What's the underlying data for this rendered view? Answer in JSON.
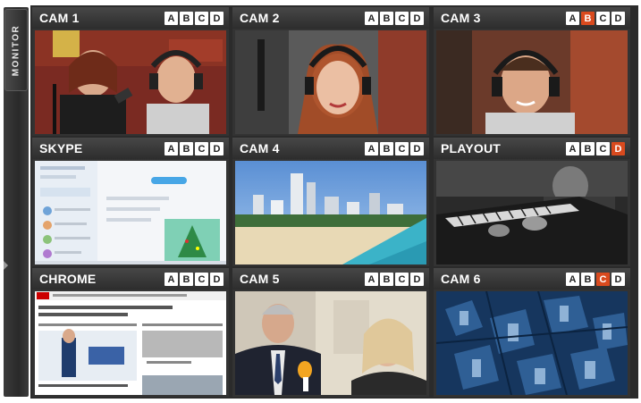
{
  "monitor_label": "MONITOR",
  "tally_letters": [
    "A",
    "B",
    "C",
    "D"
  ],
  "tally_active_color": "#d94a1e",
  "cells": [
    {
      "title": "CAM 1",
      "active": []
    },
    {
      "title": "CAM 2",
      "active": []
    },
    {
      "title": "CAM 3",
      "active": [
        "B"
      ]
    },
    {
      "title": "SKYPE",
      "active": []
    },
    {
      "title": "CAM 4",
      "active": []
    },
    {
      "title": "PLAYOUT",
      "active": [
        "D"
      ]
    },
    {
      "title": "CHROME",
      "active": []
    },
    {
      "title": "CAM 5",
      "active": []
    },
    {
      "title": "CAM 6",
      "active": [
        "C"
      ]
    }
  ]
}
